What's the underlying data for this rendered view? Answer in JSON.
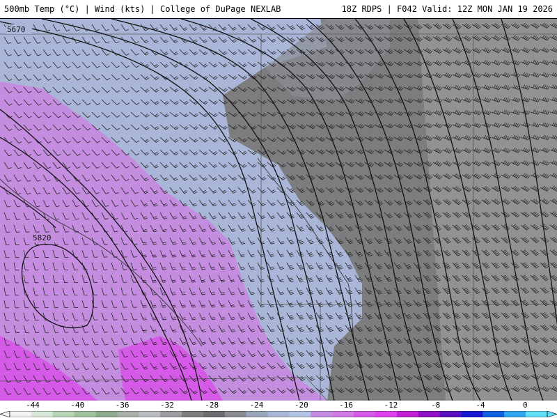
{
  "header": {
    "left_title": "500mb Temp (°C) | Wind (kts) | College of DuPage NEXLAB",
    "right_title": "18Z RDPS | F042 Valid: 12Z MON JAN 19 2026"
  },
  "map": {
    "contour_labels": [
      "5670",
      "5820"
    ],
    "field_palette": {
      "deep_magenta": "#d65ae8",
      "violet": "#c48de0",
      "lavender": "#a9b6d8",
      "steel": "#8b8d94",
      "gray": "#7a7a7a",
      "light_gray": "#a7aaa8"
    },
    "overlays": [
      "height-contours",
      "wind-barbs",
      "coastlines",
      "state-borders"
    ]
  },
  "colorbar": {
    "ticks": [
      "-44",
      "-40",
      "-36",
      "-32",
      "-28",
      "-24",
      "-20",
      "-16",
      "-12",
      "-8",
      "-4",
      "0"
    ],
    "colors": [
      "#f2f2f2",
      "#d9e9d9",
      "#b6d4b6",
      "#9fc39f",
      "#8fab8f",
      "#a9b0a9",
      "#b9bcbf",
      "#9c9ca0",
      "#7e7e7e",
      "#6c6c70",
      "#8b8d94",
      "#9aa6b9",
      "#a9b6d8",
      "#b4c4e4",
      "#c48de0",
      "#d07ae6",
      "#d65ae8",
      "#e040ee",
      "#c21fd7",
      "#9010c8",
      "#5a10c0",
      "#1818d0",
      "#1060e0",
      "#30a8f0",
      "#60e0f8"
    ]
  }
}
